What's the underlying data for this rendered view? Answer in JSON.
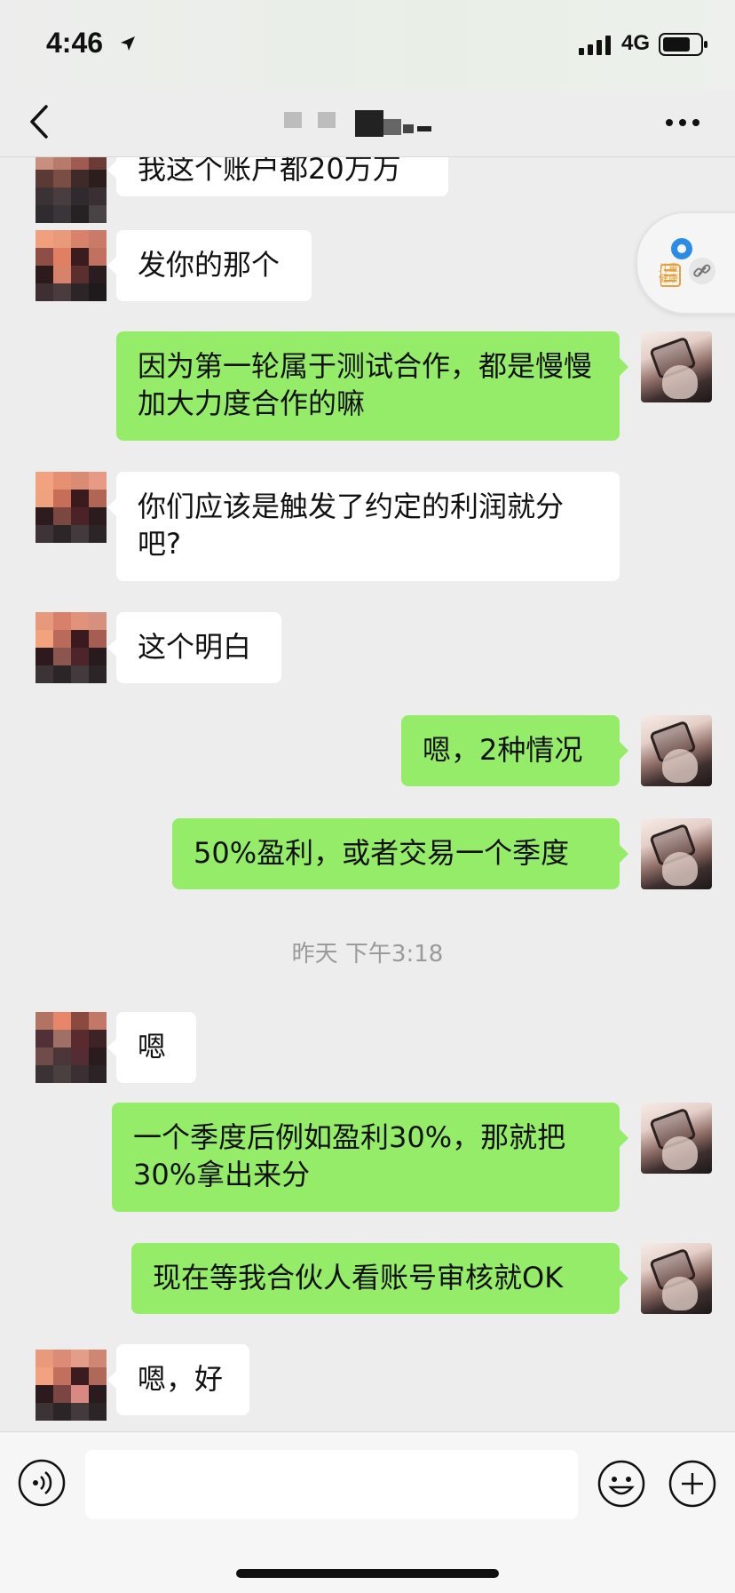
{
  "status_bar": {
    "time": "4:46",
    "network": "4G"
  },
  "nav": {
    "title": ""
  },
  "messages": [
    {
      "side": "left",
      "text": "我这个账户都20万万"
    },
    {
      "side": "left",
      "text": "发你的那个"
    },
    {
      "side": "right",
      "text": "因为第一轮属于测试合作，都是慢慢加大力度合作的嘛"
    },
    {
      "side": "left",
      "text": "你们应该是触发了约定的利润就分吧?"
    },
    {
      "side": "left",
      "text": "这个明白"
    },
    {
      "side": "right",
      "text": "嗯，2种情况"
    },
    {
      "side": "right",
      "text": "50%盈利，或者交易一个季度"
    },
    {
      "side": "left",
      "text": "嗯"
    },
    {
      "side": "right",
      "text": "一个季度后例如盈利30%，那就把30%拿出来分"
    },
    {
      "side": "right",
      "text": "现在等我合伙人看账号审核就OK"
    },
    {
      "side": "left",
      "text": "嗯，好"
    }
  ],
  "timestamp": "昨天 下午3:18",
  "floating_window": {
    "label": "儿童健康"
  },
  "input": {
    "value": "",
    "placeholder": ""
  },
  "icons": {
    "back": "chevron-left-icon",
    "more": "more-dots-icon",
    "location": "location-arrow-icon",
    "voice": "voice-icon",
    "emoji": "emoji-icon",
    "plus": "plus-icon",
    "link": "link-icon"
  },
  "colors": {
    "chat_bg": "#ededed",
    "bubble_self": "#95ec69",
    "bubble_other": "#ffffff",
    "timestamp": "#9a9a9a"
  }
}
